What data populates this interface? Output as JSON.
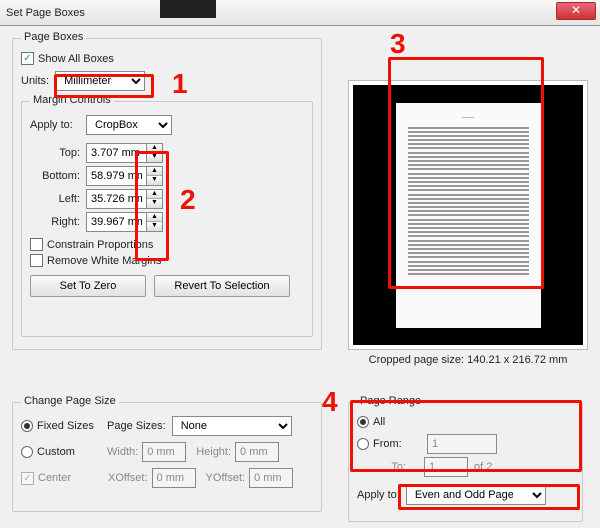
{
  "window": {
    "title": "Set Page Boxes"
  },
  "page_boxes": {
    "legend": "Page Boxes",
    "show_all_label": "Show All Boxes",
    "show_all_checked": true,
    "units_label": "Units:",
    "units_value": "Millimeters",
    "margin_controls": {
      "legend": "Margin Controls",
      "apply_to_label": "Apply to:",
      "apply_to_value": "CropBox",
      "top_label": "Top:",
      "top_value": "3.707 mm",
      "bottom_label": "Bottom:",
      "bottom_value": "58.979 mm",
      "left_label": "Left:",
      "left_value": "35.726 mm",
      "right_label": "Right:",
      "right_value": "39.967 mm",
      "constrain_label": "Constrain Proportions",
      "remove_white_label": "Remove White Margins",
      "set_zero_label": "Set To Zero",
      "revert_label": "Revert To Selection"
    }
  },
  "preview": {
    "caption": "Cropped page size: 140.21 x 216.72 mm"
  },
  "change_page_size": {
    "legend": "Change Page Size",
    "fixed_label": "Fixed Sizes",
    "custom_label": "Custom",
    "center_label": "Center",
    "page_sizes_label": "Page Sizes:",
    "page_sizes_value": "None",
    "width_label": "Width:",
    "width_value": "0 mm",
    "height_label": "Height:",
    "height_value": "0 mm",
    "xoffset_label": "XOffset:",
    "xoffset_value": "0 mm",
    "yoffset_label": "YOffset:",
    "yoffset_value": "0 mm"
  },
  "page_range": {
    "legend": "Page Range",
    "all_label": "All",
    "from_label": "From:",
    "from_value": "1",
    "to_label": "To:",
    "to_value": "1",
    "of_label": "of 2",
    "apply_to_label": "Apply to:",
    "apply_to_value": "Even and Odd Pages"
  },
  "annotations": {
    "n1": "1",
    "n2": "2",
    "n3": "3",
    "n4": "4"
  }
}
